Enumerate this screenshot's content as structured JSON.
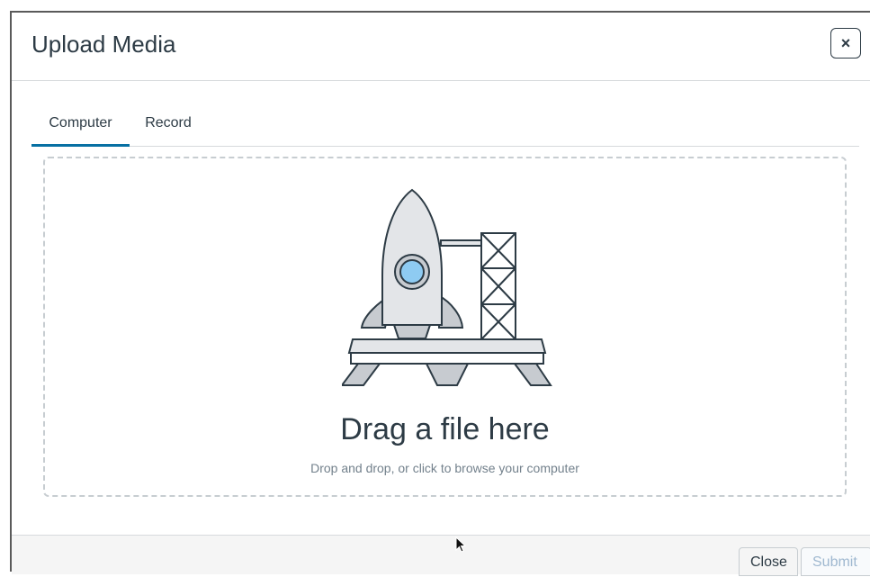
{
  "dialog": {
    "title": "Upload Media",
    "close_x_label": "×"
  },
  "tabs": [
    {
      "label": "Computer",
      "active": true
    },
    {
      "label": "Record",
      "active": false
    }
  ],
  "dropzone": {
    "title": "Drag a file here",
    "subtitle": "Drop and drop, or click to browse your computer",
    "illustration": "rocket-launchpad-icon"
  },
  "footer": {
    "close_label": "Close",
    "submit_label": "Submit"
  },
  "colors": {
    "accent": "#0770a3",
    "text": "#2d3b45",
    "muted": "#73818c",
    "rocket_window": "#8ecbf2",
    "disabled_text": "#9fb8d0"
  }
}
